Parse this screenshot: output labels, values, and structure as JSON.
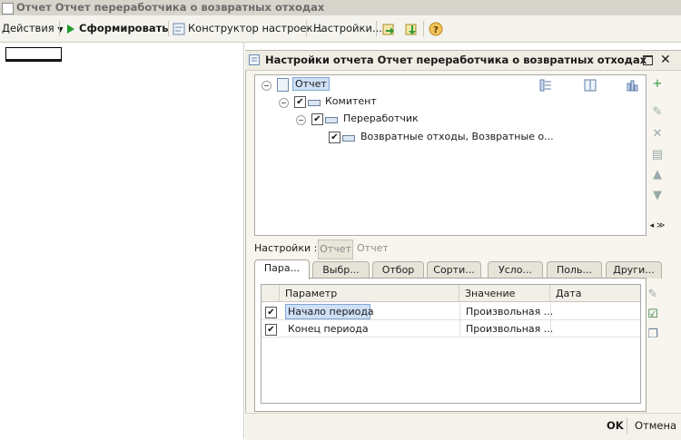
{
  "window": {
    "title": "Отчет  Отчет переработчика о возвратных отходах"
  },
  "toolbar": {
    "actions_label": "Действия",
    "generate_label": "Сформировать",
    "constructor_label": "Конструктор настроек...",
    "settings_label": "Настройки..."
  },
  "dialog": {
    "title": "Настройки отчета  Отчет переработчика о возвратных отходах",
    "tree": {
      "root": "Отчет",
      "level1": "Комитент",
      "level2": "Переработчик",
      "level3": "Возвратные отходы, Возвратные о..."
    },
    "settings_label": "Настройки :",
    "settings_mode_active": "Отчет",
    "settings_mode_other": "Отчет",
    "tabs": [
      "Пара...",
      "Выбр...",
      "Отбор",
      "Сорти...",
      "Усло...",
      "Поль...",
      "Други..."
    ],
    "params": {
      "headers": [
        "Параметр",
        "Значение",
        "Дата"
      ],
      "rows": [
        {
          "checked": true,
          "param": "Начало периода",
          "value": "Произвольная ...",
          "date": ""
        },
        {
          "checked": true,
          "param": "Конец периода",
          "value": "Произвольная ...",
          "date": ""
        }
      ]
    },
    "ok_label": "OK",
    "cancel_label": "Отмена"
  },
  "colors": {
    "accent_play": "#1f9a2a",
    "selection": "#cfe0f6",
    "dialog_bg": "#f7f5ee"
  }
}
